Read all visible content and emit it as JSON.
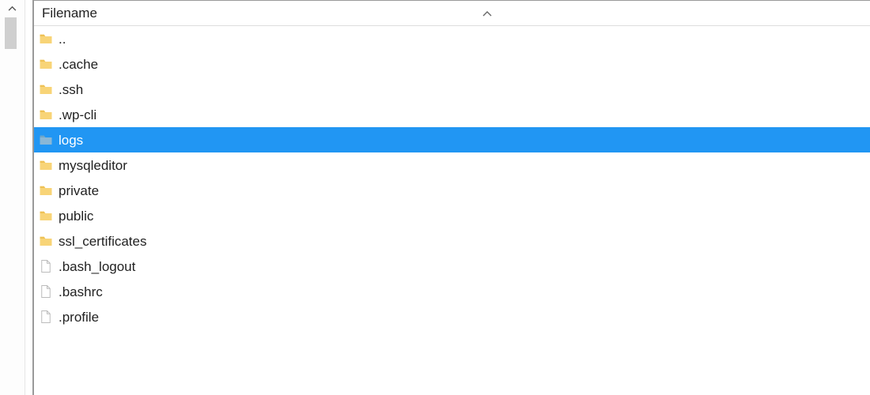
{
  "header": {
    "filename_label": "Filename",
    "sort_direction": "asc"
  },
  "selection": "logs",
  "items": [
    {
      "name": "..",
      "type": "folder",
      "selected": false
    },
    {
      "name": ".cache",
      "type": "folder",
      "selected": false
    },
    {
      "name": ".ssh",
      "type": "folder",
      "selected": false
    },
    {
      "name": ".wp-cli",
      "type": "folder",
      "selected": false
    },
    {
      "name": "logs",
      "type": "folder",
      "selected": true
    },
    {
      "name": "mysqleditor",
      "type": "folder",
      "selected": false
    },
    {
      "name": "private",
      "type": "folder",
      "selected": false
    },
    {
      "name": "public",
      "type": "folder",
      "selected": false
    },
    {
      "name": "ssl_certificates",
      "type": "folder",
      "selected": false
    },
    {
      "name": ".bash_logout",
      "type": "file",
      "selected": false
    },
    {
      "name": ".bashrc",
      "type": "file",
      "selected": false
    },
    {
      "name": ".profile",
      "type": "file",
      "selected": false
    }
  ]
}
